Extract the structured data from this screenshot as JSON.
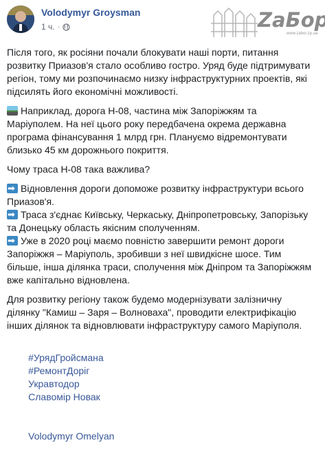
{
  "post": {
    "author": "Volodymyr Groysman",
    "time": "1 ч.",
    "separator": "·",
    "watermark": {
      "text": "ZaБор",
      "url": "www.zabor.zp.ua"
    },
    "paragraphs": [
      [
        "Після того, як росіяни почали блокувати наші порти, питання",
        "розвитку Приазов'я стало особливо гостро. Уряд буде підтримувати",
        "регіон, тому ми розпочинаємо низку інфраструктурних проектів, які",
        "підсилять його економічні можливості."
      ],
      [
        "Наприклад, дорога Н-08, частина між Запоріжжям та",
        "Маріуполем. На неї цього року передбачена окрема державна",
        "програма фінансування 1 млрд грн. Плануємо відремонтувати",
        "близько 45 км дорожнього покриття."
      ],
      [
        "Чому траса Н-08 така важлива?"
      ],
      [
        "Відновлення дороги допоможе розвитку інфраструктури всього",
        "Приазов'я."
      ],
      [
        "Траса з'єднає Київську, Черкаську, Дніпропетровську, Запорізьку",
        "та Донецьку область якісним сполученням."
      ],
      [
        "Уже в 2020 році маємо повністю завершити ремонт дороги",
        "Запоріжжя – Маріуполь, зробивши з неї швидкісне шосе. Тим",
        "більше, інша ділянка траси, сполучення між Дніпром та Запоріжжям",
        "вже капітально відновлена."
      ],
      [
        "Для розвитку регіону також будемо модернізувати залізничну",
        "ділянку \"Камиш – Заря – Волноваха\", проводити електрифікацію",
        "інших ділянок та відновлювати інфраструктуру самого Маріуполя."
      ]
    ],
    "hashtags": {
      "line1": [
        "#УрядГройсмана",
        "#РемонтДоріг",
        "Укравтодор",
        "Славомір Новак"
      ],
      "line2": [
        "Volodymyr Omelyan"
      ]
    },
    "icons": {
      "road": "road-emoji",
      "arrow": "right-arrow-emoji",
      "globe": "globe-icon"
    },
    "colors": {
      "link": "#365899",
      "hashtag": "#385898",
      "meta": "#606770",
      "text": "#1c1e21"
    }
  }
}
